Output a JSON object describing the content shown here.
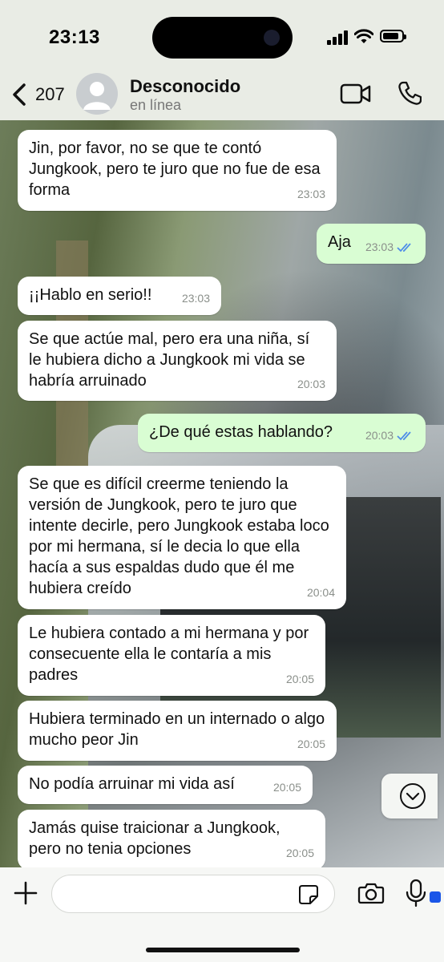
{
  "status_bar": {
    "time": "23:13"
  },
  "header": {
    "unread_count": "207",
    "contact_name": "Desconocido",
    "contact_status": "en línea",
    "icons": [
      "chevron-left-icon",
      "video-call-icon",
      "phone-icon"
    ]
  },
  "messages": [
    {
      "direction": "in",
      "text": "Jin, por favor, no se que te contó Jungkook, pero te juro que no fue de esa forma",
      "time": "23:03"
    },
    {
      "direction": "out",
      "text": "Aja",
      "time": "23:03",
      "status": "read"
    },
    {
      "direction": "in",
      "text": "¡¡Hablo en serio!!",
      "time": "23:03"
    },
    {
      "direction": "in",
      "text": "Se que actúe mal, pero era una niña, sí le hubiera dicho a Jungkook mi vida se habría arruinado",
      "time": "20:03"
    },
    {
      "direction": "out",
      "text": "¿De qué estas hablando?",
      "time": "20:03",
      "status": "read"
    },
    {
      "direction": "in",
      "text": "Se que es difícil creerme teniendo la versión de Jungkook, pero te juro que intente decirle, pero Jungkook estaba loco por mi hermana, sí le decia lo que ella hacía a sus espaldas dudo que él me hubiera creído",
      "time": "20:04"
    },
    {
      "direction": "in",
      "text": "Le hubiera contado a mi hermana y por consecuente ella le contaría a mis padres",
      "time": "20:05"
    },
    {
      "direction": "in",
      "text": "Hubiera terminado en un internado o algo mucho peor Jin",
      "time": "20:05"
    },
    {
      "direction": "in",
      "text": "No podía arruinar mi vida así",
      "time": "20:05"
    },
    {
      "direction": "in",
      "text": "Jamás quise traicionar a Jungkook, pero no tenia opciones",
      "time": "20:05"
    }
  ],
  "input": {
    "placeholder": ""
  },
  "colors": {
    "incoming": "#ffffff",
    "outgoing": "#d9fdd3",
    "read_ticks": "#4f8de8"
  }
}
